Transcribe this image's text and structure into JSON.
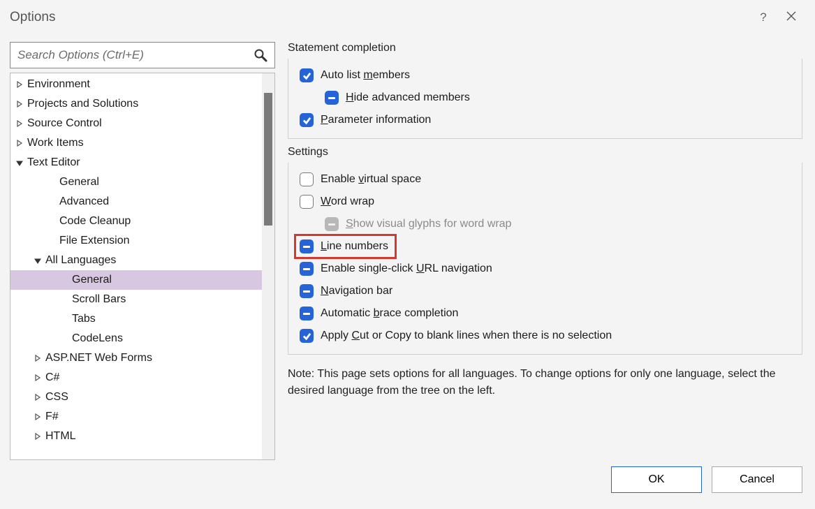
{
  "title": "Options",
  "search": {
    "placeholder": "Search Options (Ctrl+E)"
  },
  "tree": {
    "items": [
      {
        "label": "Environment",
        "depth": 0,
        "expander": "collapsed"
      },
      {
        "label": "Projects and Solutions",
        "depth": 0,
        "expander": "collapsed"
      },
      {
        "label": "Source Control",
        "depth": 0,
        "expander": "collapsed"
      },
      {
        "label": "Work Items",
        "depth": 0,
        "expander": "collapsed"
      },
      {
        "label": "Text Editor",
        "depth": 0,
        "expander": "expanded"
      },
      {
        "label": "General",
        "depth": 2,
        "expander": "none"
      },
      {
        "label": "Advanced",
        "depth": 2,
        "expander": "none"
      },
      {
        "label": "Code Cleanup",
        "depth": 2,
        "expander": "none"
      },
      {
        "label": "File Extension",
        "depth": 2,
        "expander": "none"
      },
      {
        "label": "All Languages",
        "depth": 1,
        "expander": "expanded"
      },
      {
        "label": "General",
        "depth": 3,
        "expander": "none",
        "selected": true
      },
      {
        "label": "Scroll Bars",
        "depth": 3,
        "expander": "none"
      },
      {
        "label": "Tabs",
        "depth": 3,
        "expander": "none"
      },
      {
        "label": "CodeLens",
        "depth": 3,
        "expander": "none"
      },
      {
        "label": "ASP.NET Web Forms",
        "depth": 1,
        "expander": "collapsed"
      },
      {
        "label": "C#",
        "depth": 1,
        "expander": "collapsed"
      },
      {
        "label": "CSS",
        "depth": 1,
        "expander": "collapsed"
      },
      {
        "label": "F#",
        "depth": 1,
        "expander": "collapsed"
      },
      {
        "label": "HTML",
        "depth": 1,
        "expander": "collapsed"
      }
    ]
  },
  "groups": {
    "statement_completion": {
      "label": "Statement completion",
      "auto_list": {
        "pre": "Auto list ",
        "ul": "m",
        "post": "embers",
        "state": "checked"
      },
      "hide_adv": {
        "pre": "",
        "ul": "H",
        "post": "ide advanced members",
        "state": "partial"
      },
      "param_info": {
        "pre": "",
        "ul": "P",
        "post": "arameter information",
        "state": "checked"
      }
    },
    "settings": {
      "label": "Settings",
      "virtual_space": {
        "pre": "Enable ",
        "ul": "v",
        "post": "irtual space",
        "state": "unchecked"
      },
      "word_wrap": {
        "pre": "",
        "ul": "W",
        "post": "ord wrap",
        "state": "unchecked"
      },
      "show_glyphs": {
        "pre": "",
        "ul": "S",
        "post": "how visual glyphs for word wrap",
        "state": "disabled"
      },
      "line_numbers": {
        "pre": "",
        "ul": "L",
        "post": "ine numbers",
        "state": "partial",
        "highlighted": true
      },
      "url_nav": {
        "pre": "Enable single-click ",
        "ul": "U",
        "post": "RL navigation",
        "state": "partial"
      },
      "nav_bar": {
        "pre": "",
        "ul": "N",
        "post": "avigation bar",
        "state": "partial"
      },
      "brace": {
        "pre": "Automatic ",
        "ul": "b",
        "post": "race completion",
        "state": "partial"
      },
      "blank_copy": {
        "pre": "Apply ",
        "ul": "C",
        "post": "ut or Copy to blank lines when there is no selection",
        "state": "checked"
      }
    }
  },
  "note": "Note: This page sets options for all languages. To change options for only one language, select the desired language from the tree on the left.",
  "buttons": {
    "ok": "OK",
    "cancel": "Cancel"
  }
}
